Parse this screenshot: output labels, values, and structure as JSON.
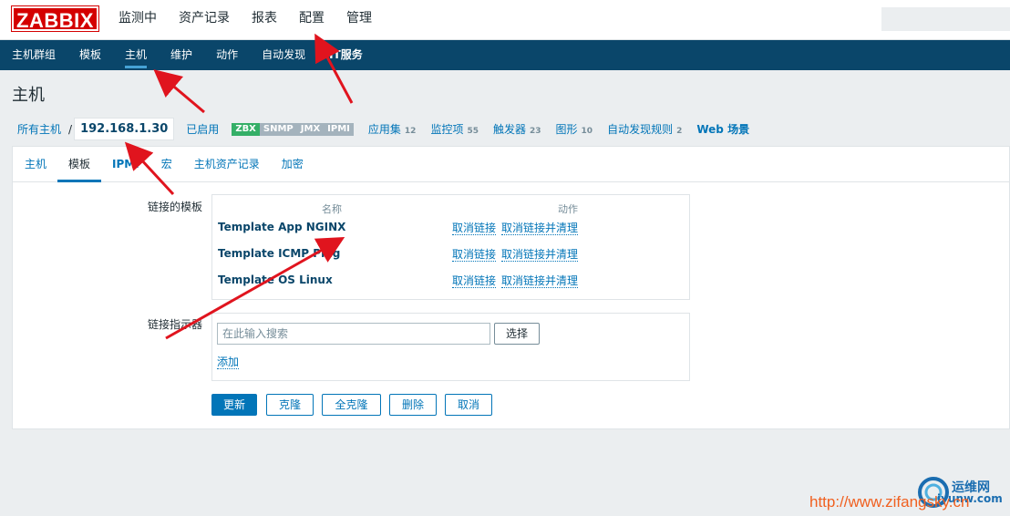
{
  "logo": "ZABBIX",
  "main_menu": [
    "监测中",
    "资产记录",
    "报表",
    "配置",
    "管理"
  ],
  "sub_menu": [
    "主机群组",
    "模板",
    "主机",
    "维护",
    "动作",
    "自动发现",
    "IT服务"
  ],
  "page_title": "主机",
  "breadcrumb": {
    "all_hosts": "所有主机",
    "separator": "/",
    "host": "192.168.1.30"
  },
  "status": "已启用",
  "availability": [
    "ZBX",
    "SNMP",
    "JMX",
    "IPMI"
  ],
  "host_links": [
    {
      "label": "应用集",
      "count": "12"
    },
    {
      "label": "监控项",
      "count": "55"
    },
    {
      "label": "触发器",
      "count": "23"
    },
    {
      "label": "图形",
      "count": "10"
    },
    {
      "label": "自动发现规则",
      "count": "2"
    },
    {
      "label": "Web 场景",
      "count": ""
    }
  ],
  "tabs": [
    "主机",
    "模板",
    "IPMI",
    "宏",
    "主机资产记录",
    "加密"
  ],
  "linked_templates": {
    "label": "链接的模板",
    "col_name": "名称",
    "col_action": "动作",
    "rows": [
      {
        "name": "Template App NGINX",
        "unlink": "取消链接",
        "unlink_clear": "取消链接并清理"
      },
      {
        "name": "Template ICMP Ping",
        "unlink": "取消链接",
        "unlink_clear": "取消链接并清理"
      },
      {
        "name": "Template OS Linux",
        "unlink": "取消链接",
        "unlink_clear": "取消链接并清理"
      }
    ]
  },
  "link_indicator": {
    "label": "链接指示器",
    "placeholder": "在此输入搜索",
    "select": "选择",
    "add": "添加"
  },
  "buttons": {
    "update": "更新",
    "clone": "克隆",
    "full_clone": "全克隆",
    "delete": "删除",
    "cancel": "取消"
  },
  "watermark": {
    "brand": "运维网",
    "brand_sub": "iyunw.com",
    "url": "http://www.zifangsky.cn"
  },
  "colors": {
    "header": "#0a466a",
    "link": "#0275b8",
    "status": "#429e47",
    "zbx": "#34af67",
    "arrow": "#e0141e"
  }
}
